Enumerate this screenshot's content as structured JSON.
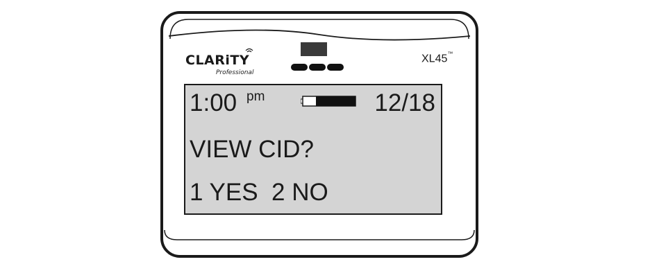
{
  "device": {
    "brand": "CLARiTY",
    "brand_sub": "Professional",
    "model": "XL45",
    "model_mark": "™"
  },
  "display": {
    "time": "1:00",
    "ampm": "pm",
    "battery_icon": "battery-icon",
    "battery_level": 0.75,
    "date": "12/18",
    "prompt": "VIEW CID?",
    "options": "1 YES  2 NO"
  },
  "colors": {
    "screen_bg": "#d4d4d4",
    "outline": "#1a1a1a",
    "battery_fill": "#111111",
    "sensor": "#3a3a3a"
  }
}
